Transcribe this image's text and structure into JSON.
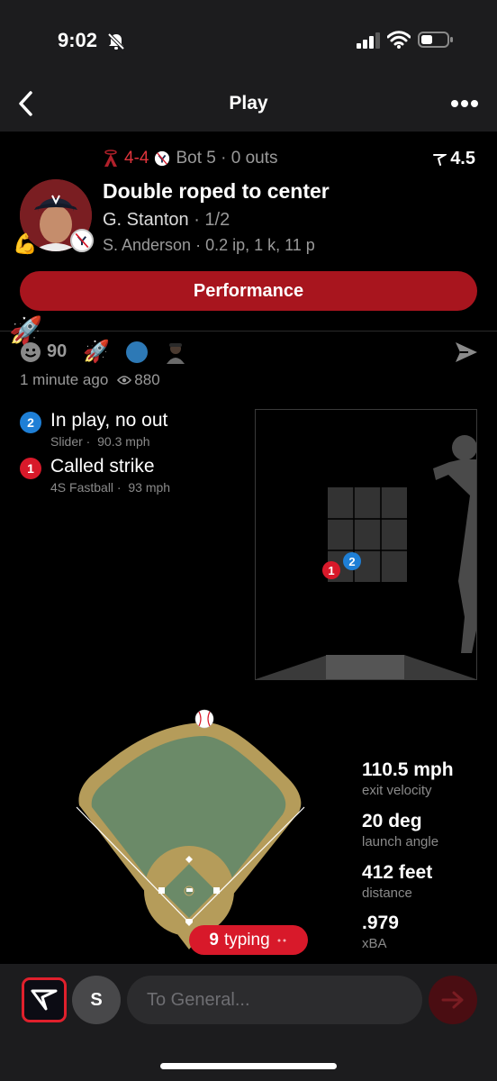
{
  "status": {
    "time": "9:02"
  },
  "nav": {
    "title": "Play"
  },
  "game": {
    "score": "4-4",
    "inning": "Bot 5 · 0 outs",
    "odds": "4.5",
    "play_title": "Double roped to center",
    "batter_name": "G. Stanton",
    "batter_line": "· 1/2",
    "pitcher_line": "S. Anderson · 0.2 ip, 1 k, 11 p",
    "performance_label": "Performance"
  },
  "reactions": {
    "count": "90",
    "time_ago": "1 minute ago",
    "views": "880"
  },
  "pitches": [
    {
      "number": "2",
      "result": "In play, no out",
      "pitch_type": "Slider",
      "speed": "90.3 mph",
      "color": "#1e7fd6"
    },
    {
      "number": "1",
      "result": "Called strike",
      "pitch_type": "4S Fastball",
      "speed": "93 mph",
      "color": "#d8192a"
    }
  ],
  "hit_stats": [
    {
      "value": "110.5 mph",
      "label": "exit velocity"
    },
    {
      "value": "20 deg",
      "label": "launch angle"
    },
    {
      "value": "412 feet",
      "label": "distance"
    },
    {
      "value": ".979",
      "label": "xBA"
    }
  ],
  "typing": {
    "count": "9",
    "label": "typing"
  },
  "composer": {
    "avatar_letter": "S",
    "placeholder": "To General..."
  },
  "colors": {
    "accent": "#a8151e",
    "score_red": "#e0343c",
    "field_green": "#6b8a68",
    "dirt": "#b59c5a"
  },
  "icons": [
    "bell-slash-icon",
    "signal-icon",
    "wifi-icon",
    "battery-icon",
    "back-chevron-icon",
    "more-icon",
    "angels-logo-icon",
    "yankees-logo-icon",
    "odds-arrow-icon",
    "muscle-emoji-icon",
    "rocket-emoji-icon",
    "smile-icon",
    "eye-icon",
    "send-share-icon",
    "baseball-icon",
    "send-arrow-icon"
  ]
}
